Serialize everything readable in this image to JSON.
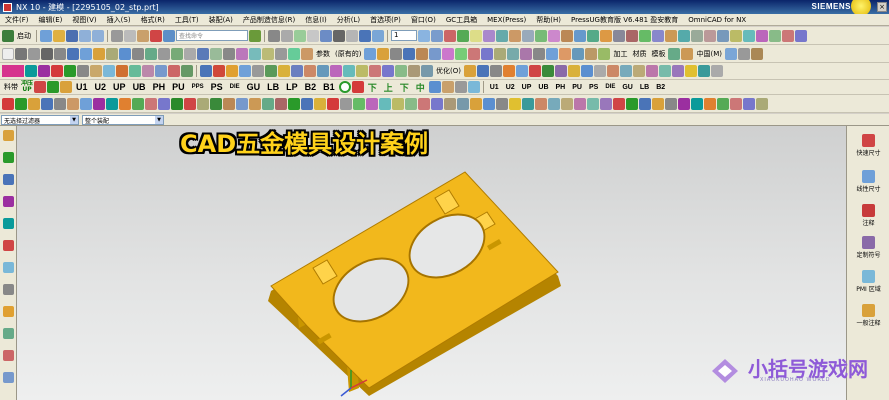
{
  "window": {
    "title": "NX 10 - 建模 - [2295105_02_stp.prt]",
    "brand": "SIEMENS"
  },
  "menu": [
    "文件(F)",
    "编辑(E)",
    "视图(V)",
    "插入(S)",
    "格式(R)",
    "工具(T)",
    "装配(A)",
    "产品制造信息(R)",
    "信息(I)",
    "分析(L)",
    "首选项(P)",
    "窗口(O)",
    "GC工具箱",
    "MEX(Press)",
    "帮助(H)",
    "PressUG教育版 V6.481 盈安教育",
    "OmniCAD for NX"
  ],
  "toolbar1": {
    "start_label": "启动",
    "search_placeholder": "查找命令",
    "layer_value": "1"
  },
  "toolbar2": {
    "params_label": "参数",
    "origin_label": "(原有的)",
    "mark_label": "加工",
    "material_label": "材质",
    "template_label": "模板",
    "color_label": "中国(M)"
  },
  "toolbar3": {
    "optimize_label": "优化(O)"
  },
  "toolbar4": {
    "part_label": "料带",
    "stamp_label": "冲压\nUP",
    "plates_left": [
      "U1",
      "U2",
      "UP",
      "UB",
      "PH",
      "PU",
      "PPS",
      "PS",
      "DIE",
      "GU",
      "LB",
      "LP",
      "B2",
      "B1"
    ],
    "plates_right": [
      "U1",
      "U2",
      "UP",
      "UB",
      "PH",
      "PU",
      "PS",
      "DIE",
      "GU",
      "LB",
      "B2"
    ],
    "nav_labels": [
      "下",
      "上",
      "下",
      "中"
    ]
  },
  "filterbar": {
    "filter": "无选择过滤器",
    "scope": "整个装配"
  },
  "overlay": {
    "title": "CAD五金模具设计案例"
  },
  "right_panel": [
    {
      "icon": "quick-dimension-icon",
      "label": "快速尺寸"
    },
    {
      "icon": "linear-dimension-icon",
      "label": "线性尺寸"
    },
    {
      "icon": "note-icon",
      "label": "注释"
    },
    {
      "icon": "custom-symbol-icon",
      "label": "定制符号"
    },
    {
      "icon": "pmi-region-icon",
      "label": "PMI 区域"
    },
    {
      "icon": "general-note-icon",
      "label": "一般注释"
    }
  ],
  "watermark": {
    "text": "小括号游戏网",
    "sub": "XIAOKUOHAO WORLD"
  },
  "colors": {
    "part": "#f2b81c",
    "title_fill": "#ffd21a",
    "titlebar": "#0a246a",
    "watermark": "#8e5ad8"
  }
}
